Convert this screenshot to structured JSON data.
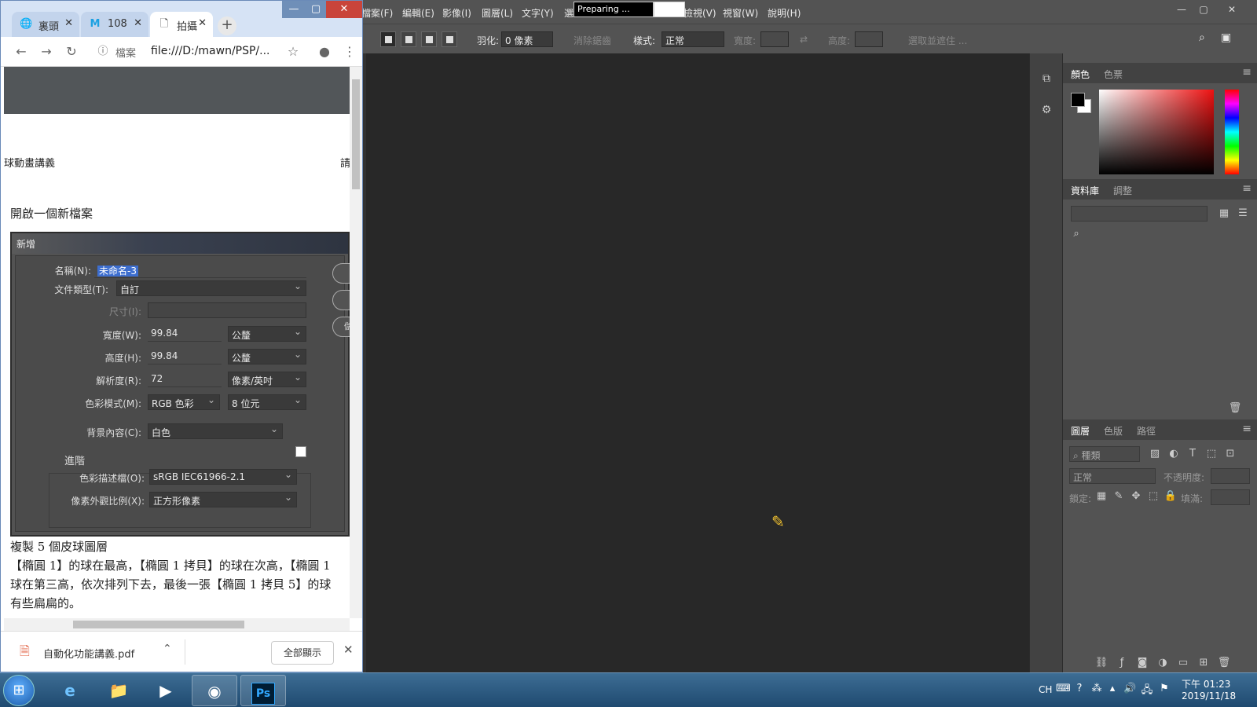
{
  "ps": {
    "menus": [
      "檔案(F)",
      "編輯(E)",
      "影像(I)",
      "圖層(L)",
      "文字(Y)",
      "選",
      "檢視(V)",
      "視窗(W)",
      "說明(H)"
    ],
    "preparing": "Preparing ...",
    "options": {
      "feather_label": "羽化:",
      "feather_value": "0 像素",
      "antialias_label": "消除鋸齒",
      "style_label": "樣式:",
      "style_value": "正常",
      "width_label": "寬度:",
      "height_label": "高度:",
      "select_mask_label": "選取並遮住 ..."
    },
    "panels": {
      "color_tabs": [
        "顏色",
        "色票"
      ],
      "library_tabs": [
        "資料庫",
        "調整"
      ],
      "layer_tabs": [
        "圖層",
        "色版",
        "路徑"
      ],
      "kind_label": "種類",
      "blend_mode": "正常",
      "opacity_label": "不透明度:",
      "lock_label": "鎖定:",
      "fill_label": "填滿:"
    },
    "colors": {
      "foreground": "#000000",
      "background": "#ffffff"
    }
  },
  "chrome": {
    "tabs": [
      {
        "label": "裏頭",
        "favicon": "globe-icon"
      },
      {
        "label": "108",
        "favicon": "m-logo-icon"
      },
      {
        "label": "拍攝",
        "favicon": "file-icon"
      }
    ],
    "url_label": "檔案",
    "url": "file:///D:/mawn/PSP/...",
    "doc": {
      "header_left": "球動畫講義",
      "header_right": "請",
      "section_title": "開啟一個新檔案",
      "para_title": "複製 5 個皮球圖層",
      "para_line1": "【橢圓 1】的球在最高，【橢圓 1 拷貝】的球在次高，【橢圓 1",
      "para_line2": "球在第三高，依次排列下去，最後一張【橢圓 1 拷貝 5】的球",
      "para_line3": "有些扁扁的。"
    },
    "dialog": {
      "title": "新增",
      "name_label": "名稱(N):",
      "name_value": "未命名-3",
      "type_label": "文件類型(T):",
      "type_value": "自訂",
      "size_label": "尺寸(I):",
      "width_label": "寬度(W):",
      "width_value": "99.84",
      "width_unit": "公釐",
      "height_label": "高度(H):",
      "height_value": "99.84",
      "height_unit": "公釐",
      "res_label": "解析度(R):",
      "res_value": "72",
      "res_unit": "像素/英吋",
      "mode_label": "色彩模式(M):",
      "mode_value": "RGB 色彩",
      "mode_bits": "8 位元",
      "bg_label": "背景內容(C):",
      "bg_value": "白色",
      "advanced_label": "進階",
      "profile_label": "色彩描述檔(O):",
      "profile_value": "sRGB IEC61966-2.1",
      "aspect_label": "像素外觀比例(X):",
      "aspect_value": "正方形像素",
      "save_button_fragment": "儲"
    },
    "download": {
      "file": "自動化功能講義.pdf",
      "show_all": "全部顯示"
    }
  },
  "taskbar": {
    "lang": "CH",
    "time": "下午 01:23",
    "date": "2019/11/18",
    "ps_label": "Ps"
  }
}
